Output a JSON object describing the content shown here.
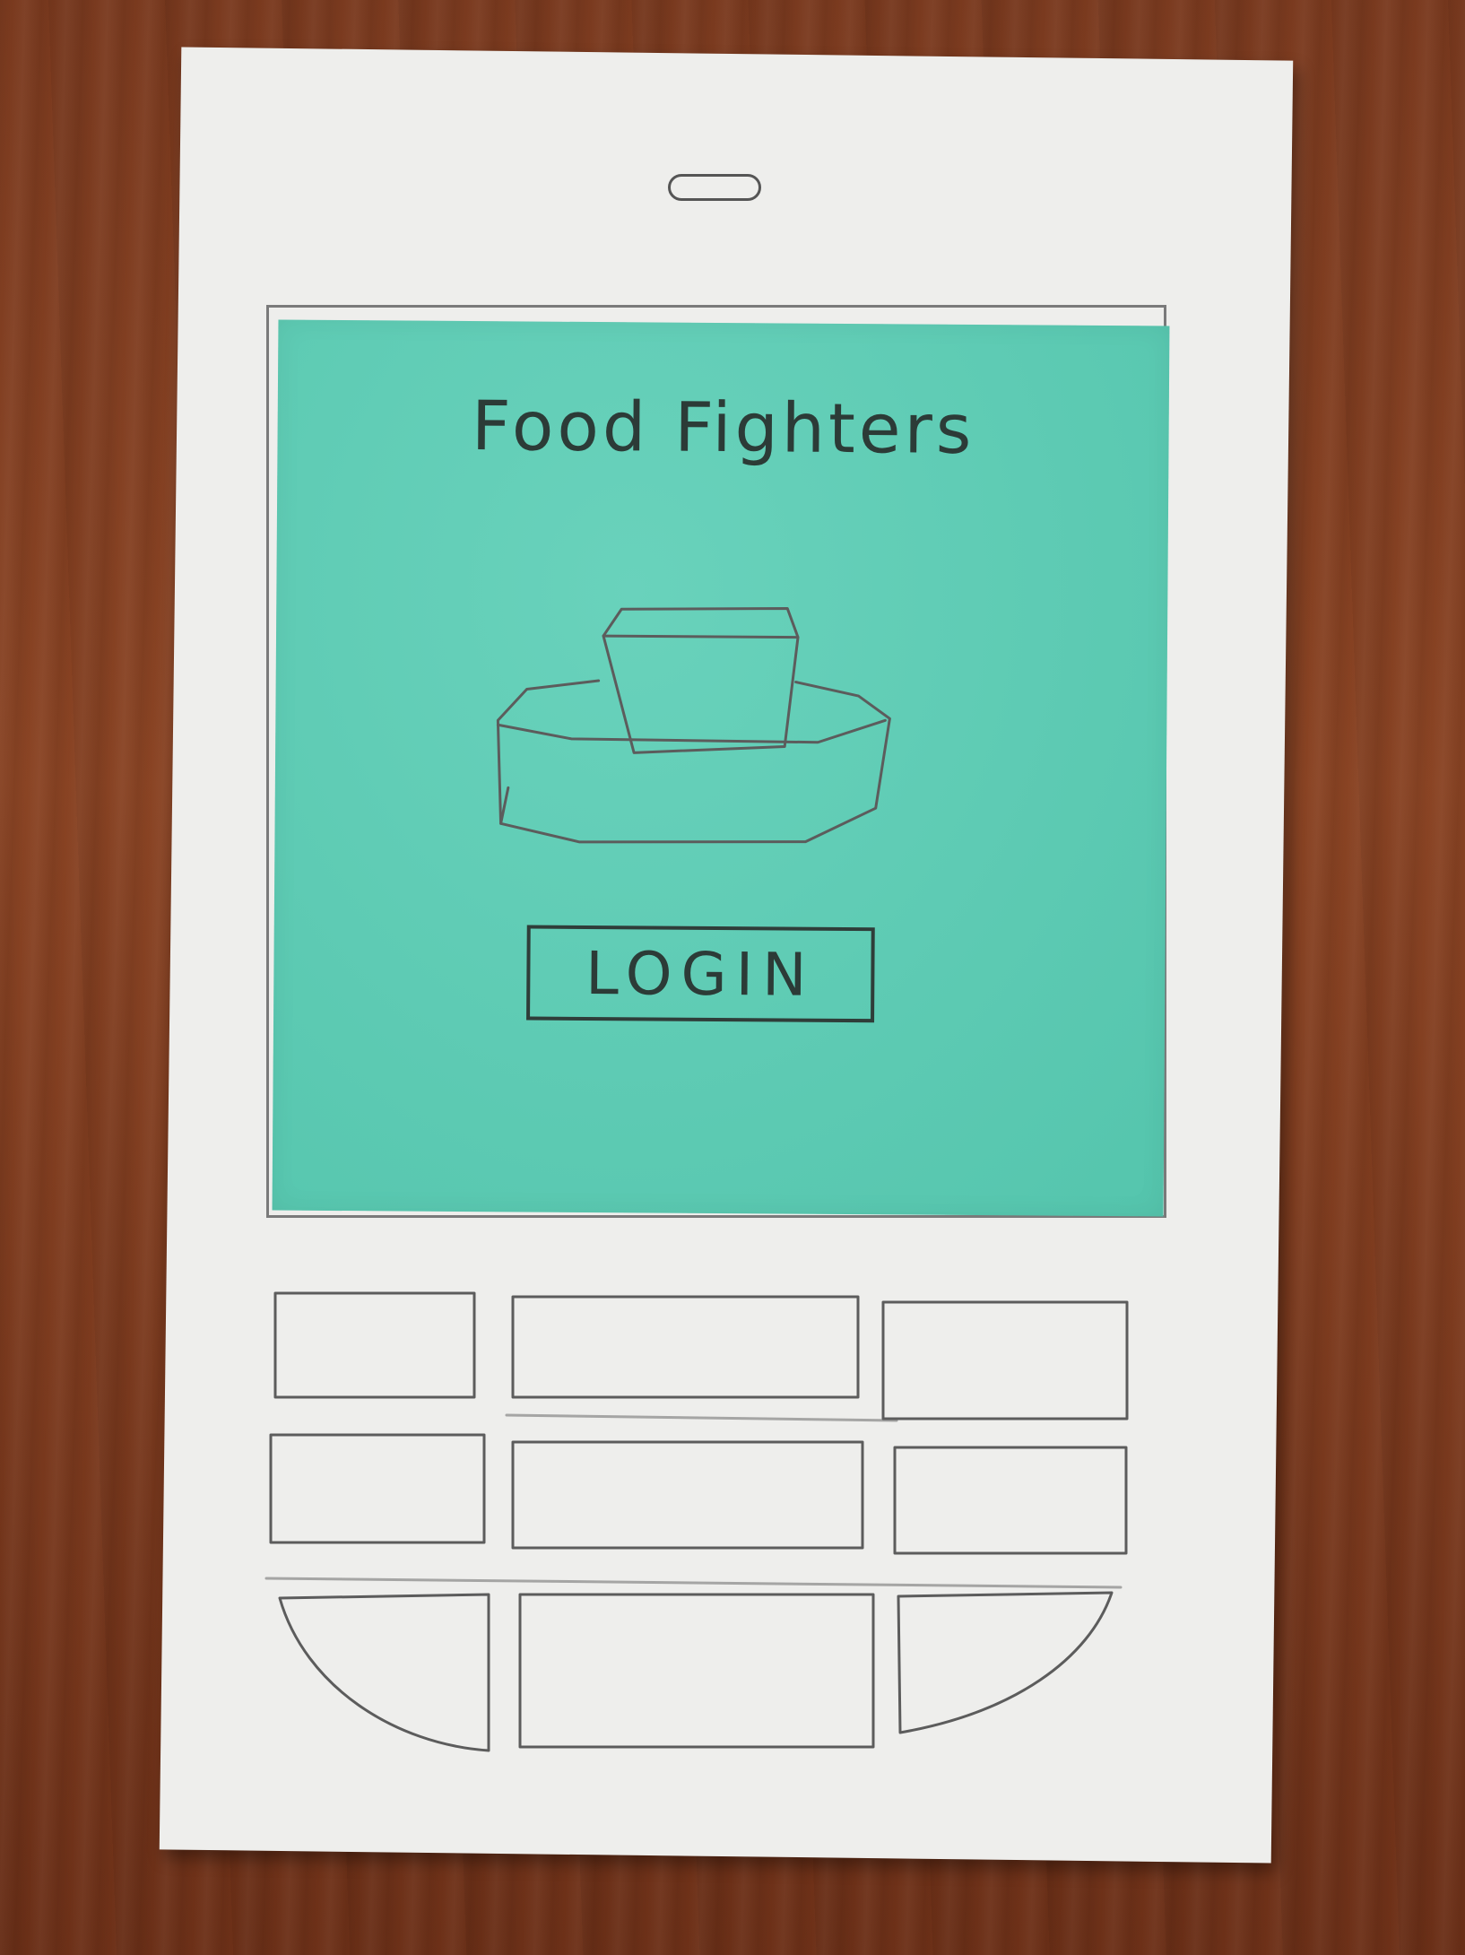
{
  "app": {
    "title": "Food Fighters",
    "login_label": "LOGIN",
    "logo_icon": "takeout-box-icon"
  },
  "keypad": {
    "rows": 3,
    "columns": 3
  },
  "colors": {
    "screen": "#58cdb4",
    "paper": "#eeeeec",
    "pencil": "#5c5c5c"
  }
}
